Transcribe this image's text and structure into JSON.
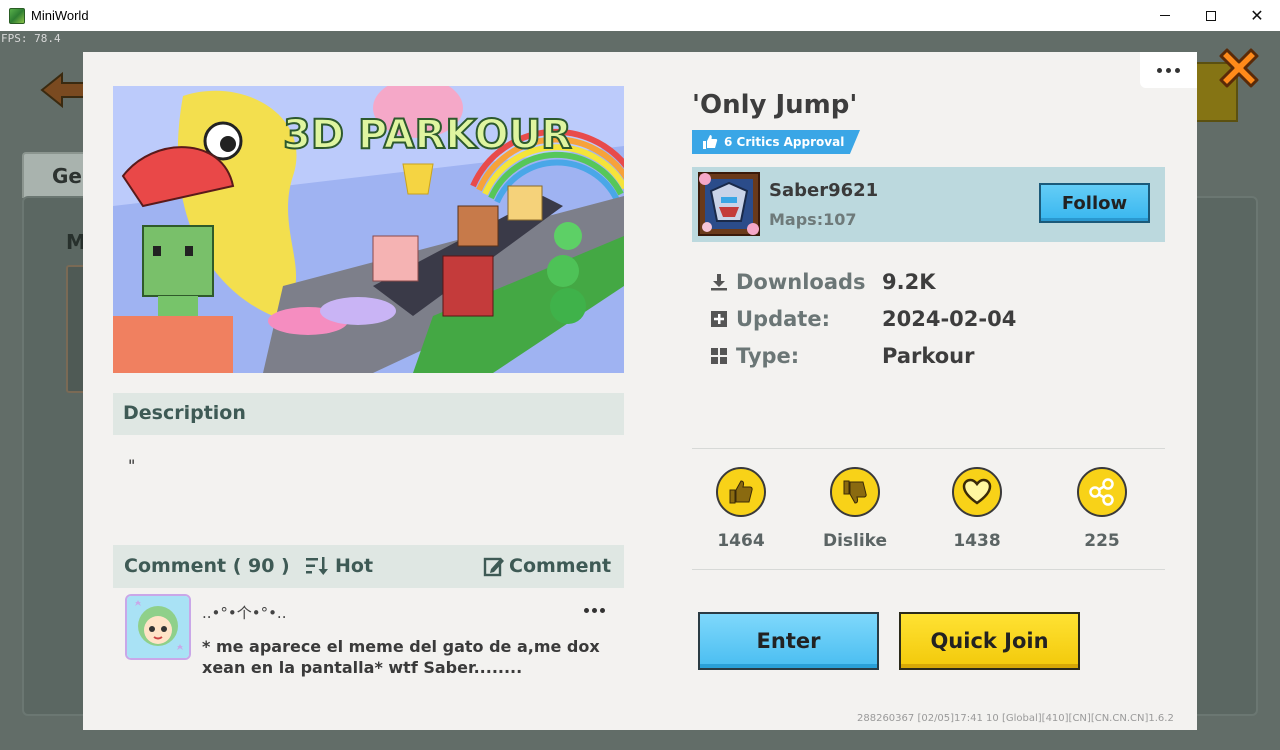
{
  "window": {
    "title": "MiniWorld",
    "fps": "FPS: 78.4"
  },
  "background": {
    "tab_label": "Ge",
    "section_label": "M"
  },
  "map": {
    "title": "'Only Jump'",
    "critics_badge": "6 Critics Approval",
    "thumbnail_caption": "3D PARKOUR",
    "description_label": "Description",
    "description_text": "\""
  },
  "author": {
    "name": "Saber9621",
    "maps": "Maps:107",
    "follow_label": "Follow"
  },
  "info": {
    "downloads_label": "Downloads",
    "downloads_value": "9.2K",
    "update_label": "Update:",
    "update_value": "2024-02-04",
    "type_label": "Type:",
    "type_value": "Parkour"
  },
  "stats": {
    "likes": "1464",
    "dislike_label": "Dislike",
    "favorites": "1438",
    "shares": "225"
  },
  "comments": {
    "header": "Comment ( 90 )",
    "sort_label": "Hot",
    "write_label": "Comment",
    "items": [
      {
        "user": "..•°•个•°•..",
        "text": "* me aparece el meme del gato de a,me dox xean en la pantalla* wtf Saber........"
      }
    ]
  },
  "buttons": {
    "enter": "Enter",
    "quick_join": "Quick Join"
  },
  "footer": "288260367  [02/05]17:41 10  [Global][410][CN][CN.CN.CN]1.6.2",
  "colors": {
    "accent_blue": "#49bdf1",
    "accent_yellow": "#f8d218",
    "panel": "#f3f2f0"
  }
}
